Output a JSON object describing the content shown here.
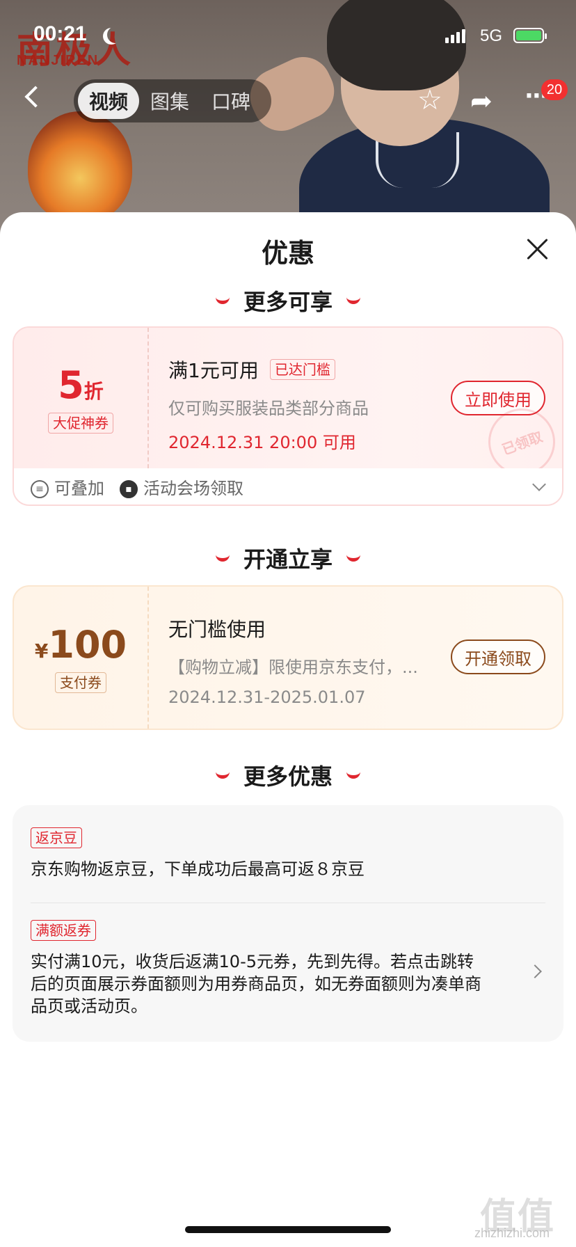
{
  "status_bar": {
    "time": "00:21",
    "network": "5G"
  },
  "brand_logo": {
    "cn": "南极人",
    "en": "NANJIREN"
  },
  "top_nav": {
    "tabs": [
      {
        "label": "视频",
        "active": true
      },
      {
        "label": "图集",
        "active": false
      },
      {
        "label": "口碑",
        "active": false
      }
    ],
    "more_badge": "20"
  },
  "sheet": {
    "title": "优惠",
    "sections": {
      "more_enjoy": "更多可享",
      "open_enjoy": "开通立享",
      "more_offers": "更多优惠"
    }
  },
  "coupon1": {
    "value_num": "5",
    "value_unit": "折",
    "type_label": "大促神券",
    "condition": "满1元可用",
    "status_tag": "已达门槛",
    "description": "仅可购买服装品类部分商品",
    "date": "2024.12.31 20:00 可用",
    "button": "立即使用",
    "stamp": "已领取",
    "footer_stack": "可叠加",
    "footer_source": "活动会场领取"
  },
  "coupon2": {
    "currency": "¥",
    "value_num": "100",
    "type_label": "支付券",
    "condition": "无门槛使用",
    "description": "【购物立减】限使用京东支付，...",
    "date": "2024.12.31-2025.01.07",
    "button": "开通领取"
  },
  "offers": [
    {
      "tag": "返京豆",
      "text": "京东购物返京豆，下单成功后最高可返８京豆"
    },
    {
      "tag": "满额返券",
      "text": "实付满10元，收货后返满10-5元券，先到先得。若点击跳转后的页面展示券面额则为用券商品页，如无券面额则为凑单商品页或活动页。"
    }
  ],
  "watermark": {
    "main": "值值值",
    "sub": "zhizhizhi.com"
  },
  "colors": {
    "accent_red": "#e0262f",
    "orange_brown": "#8b4a1c"
  }
}
